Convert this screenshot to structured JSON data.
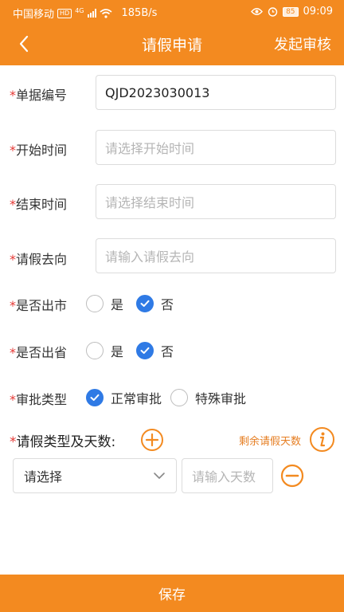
{
  "status_bar": {
    "carrier": "中国移动",
    "hd": "HD",
    "network": "4G",
    "speed": "185B/s",
    "battery": "85",
    "time": "09:09"
  },
  "header": {
    "title": "请假申请",
    "action": "发起审核"
  },
  "form": {
    "doc_no": {
      "label": "单据编号",
      "value": "QJD2023030013"
    },
    "start_time": {
      "label": "开始时间",
      "placeholder": "请选择开始时间"
    },
    "end_time": {
      "label": "结束时间",
      "placeholder": "请选择结束时间"
    },
    "destination": {
      "label": "请假去向",
      "placeholder": "请输入请假去向"
    },
    "out_city": {
      "label": "是否出市",
      "options": [
        "是",
        "否"
      ],
      "selected": "否"
    },
    "out_province": {
      "label": "是否出省",
      "options": [
        "是",
        "否"
      ],
      "selected": "否"
    },
    "approval_type": {
      "label": "审批类型",
      "options": [
        "正常审批",
        "特殊审批"
      ],
      "selected": "正常审批"
    }
  },
  "leave": {
    "title": "请假类型及天数:",
    "remaining_label": "剩余请假天数",
    "type_select": "请选择",
    "days_placeholder": "请输入天数"
  },
  "footer": {
    "save_label": "保存"
  },
  "colors": {
    "brand": "#f38a20",
    "check": "#2f7ae5",
    "required": "#e53935"
  }
}
